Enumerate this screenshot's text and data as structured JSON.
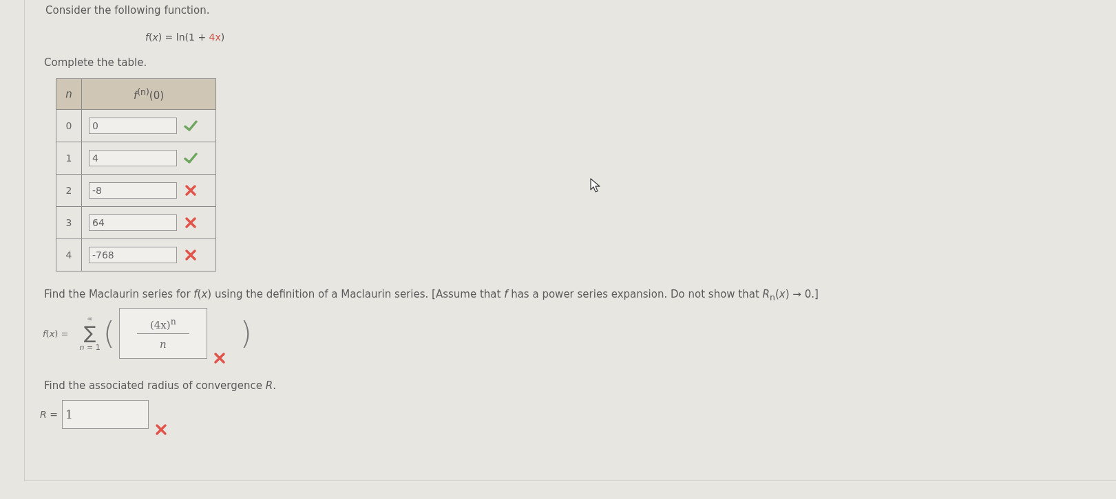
{
  "intro": "Consider the following function.",
  "function": {
    "before": "*f*(*x*) = ln(1 + ",
    "highlighted": "4x",
    "after": ")"
  },
  "table_prompt": "Complete the table.",
  "table": {
    "columns": [
      "*n*",
      "*f*$^{(n)}$(0)"
    ],
    "rows": [
      {
        "n": "0",
        "value": "0",
        "correct": true
      },
      {
        "n": "1",
        "value": "4",
        "correct": true
      },
      {
        "n": "2",
        "value": "-8",
        "correct": false
      },
      {
        "n": "3",
        "value": "64",
        "correct": false
      },
      {
        "n": "4",
        "value": "-768",
        "correct": false
      }
    ]
  },
  "series_prompt": "Find the Maclaurin series for *f*(*x*) using the definition of a Maclaurin series. [Assume that *f* has a power series expansion. Do not show that *R*$_{n}$(*x*) → 0.]",
  "series": {
    "label": "*f*(*x*) =",
    "sum_symbol": "∑",
    "upper": "∞",
    "lower": "*n* = 1",
    "open_paren": "(",
    "close_paren": ")",
    "numerator": "(4x)$^{n}$",
    "denominator": "*n*",
    "correct": false
  },
  "radius_prompt": "Find the associated radius of convergence *R*.",
  "radius": {
    "label": "*R* =",
    "value": "1",
    "correct": false
  }
}
